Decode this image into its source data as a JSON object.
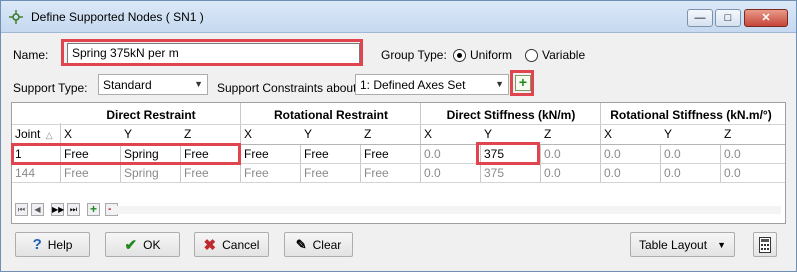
{
  "window": {
    "title": "Define Supported Nodes ( SN1 )",
    "min_label": "—",
    "max_label": "□",
    "close_label": "✕"
  },
  "form": {
    "name_label": "Name:",
    "name_value": "Spring 375kN per m",
    "group_type_label": "Group Type:",
    "group_uniform": "Uniform",
    "group_variable": "Variable",
    "group_selected": "Uniform",
    "support_type_label": "Support Type:",
    "support_type_value": "Standard",
    "constraints_label": "Support Constraints about:",
    "constraints_value": "1: Defined Axes Set",
    "add_label": "+"
  },
  "grid": {
    "groups": [
      "Direct Restraint",
      "Rotational Restraint",
      "Direct Stiffness (kN/m)",
      "Rotational Stiffness (kN.m/°)"
    ],
    "joint_header": "Joint",
    "sort_glyph": "△",
    "axes": [
      "X",
      "Y",
      "Z",
      "X",
      "Y",
      "Z",
      "X",
      "Y",
      "Z",
      "X",
      "Y",
      "Z"
    ],
    "rows": [
      {
        "joint": "1",
        "values": [
          "Free",
          "Spring",
          "Free",
          "Free",
          "Free",
          "Free",
          "0.0",
          "375",
          "0.0",
          "0.0",
          "0.0",
          "0.0"
        ]
      },
      {
        "joint": "144",
        "values": [
          "Free",
          "Spring",
          "Free",
          "Free",
          "Free",
          "Free",
          "0.0",
          "375",
          "0.0",
          "0.0",
          "0.0",
          "0.0"
        ]
      }
    ],
    "nav": [
      "⏮",
      "◀",
      "▶▶",
      "⏭",
      "+",
      "−"
    ]
  },
  "buttons": {
    "help": "Help",
    "ok": "OK",
    "cancel": "Cancel",
    "clear": "Clear",
    "table_layout": "Table Layout"
  },
  "colors": {
    "highlight": "#e0444e",
    "ok_check": "#1e8a1e",
    "cancel_x": "#c0282f"
  }
}
